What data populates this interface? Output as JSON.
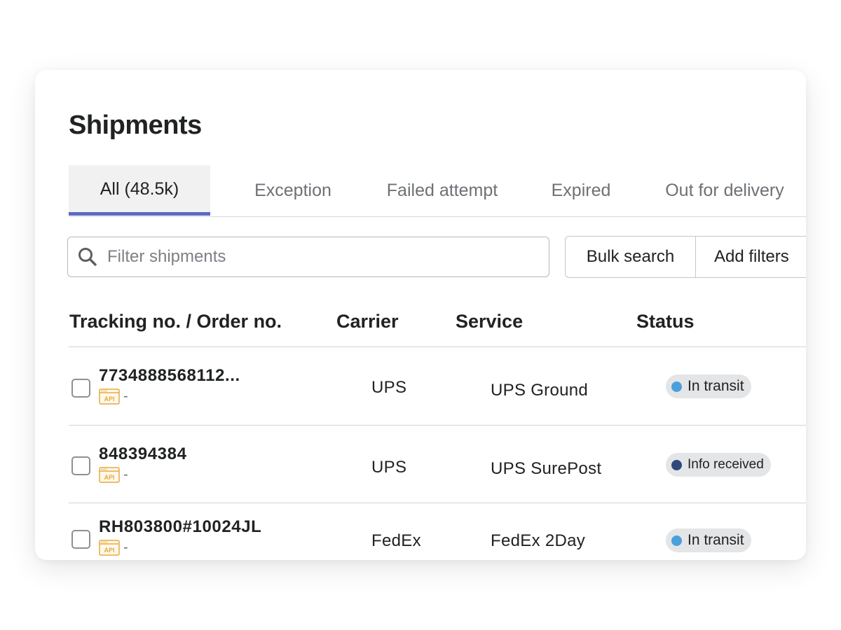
{
  "page": {
    "title": "Shipments"
  },
  "tabs": [
    {
      "label": "All (48.5k)",
      "active": true
    },
    {
      "label": "Exception",
      "active": false
    },
    {
      "label": "Failed attempt",
      "active": false
    },
    {
      "label": "Expired",
      "active": false
    },
    {
      "label": "Out for delivery",
      "active": false
    }
  ],
  "search": {
    "placeholder": "Filter shipments",
    "value": "",
    "icon": "search-icon"
  },
  "buttons": {
    "bulk_search": "Bulk search",
    "add_filters": "Add filters"
  },
  "table": {
    "columns": [
      "Tracking no. / Order no.",
      "Carrier",
      "Service",
      "Status"
    ],
    "rows": [
      {
        "tracking": "7734888568112...",
        "source": "API",
        "order": "-",
        "carrier": "UPS",
        "service": "UPS Ground",
        "status": "In transit",
        "status_color": "#4a9fdc"
      },
      {
        "tracking": "848394384",
        "source": "API",
        "order": "-",
        "carrier": "UPS",
        "service": "UPS SurePost",
        "status": "Info received",
        "status_color": "#2f4a7a"
      },
      {
        "tracking": "RH803800#10024JL",
        "source": "API",
        "order": "-",
        "carrier": "FedEx",
        "service": "FedEx 2Day",
        "status": "In transit",
        "status_color": "#4a9fdc"
      }
    ]
  },
  "colors": {
    "accent": "#5c6ac4",
    "api_badge": "#e8a93c",
    "badge_bg": "#e4e5e7"
  }
}
